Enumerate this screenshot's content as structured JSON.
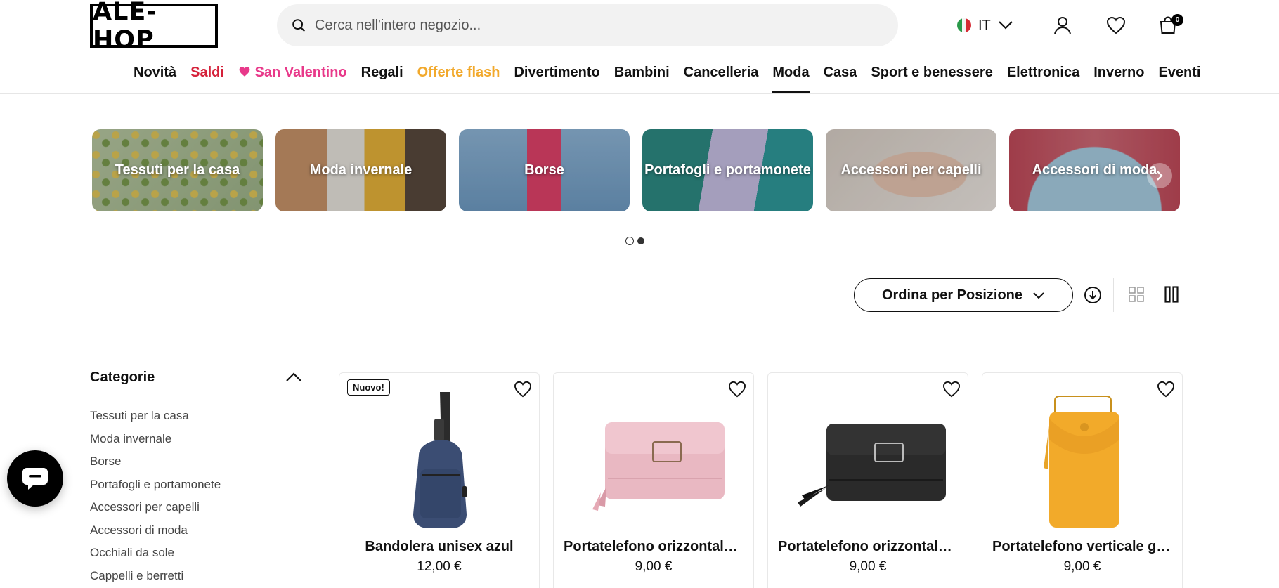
{
  "header": {
    "logo_text": "ALE-HOP",
    "search_placeholder": "Cerca nell'intero negozio...",
    "language": "IT",
    "cart_count": "0"
  },
  "nav": {
    "items": [
      {
        "label": "Novità",
        "color": "#111111"
      },
      {
        "label": "Saldi",
        "color": "#d5213a"
      },
      {
        "label": "San Valentino",
        "color": "#e8398a"
      },
      {
        "label": "Regali",
        "color": "#111111"
      },
      {
        "label": "Offerte flash",
        "color": "#f2a92c"
      },
      {
        "label": "Divertimento",
        "color": "#111111"
      },
      {
        "label": "Bambini",
        "color": "#111111"
      },
      {
        "label": "Cancelleria",
        "color": "#111111"
      },
      {
        "label": "Moda",
        "color": "#111111",
        "active": true
      },
      {
        "label": "Casa",
        "color": "#111111"
      },
      {
        "label": "Sport e benessere",
        "color": "#111111"
      },
      {
        "label": "Elettronica",
        "color": "#111111"
      },
      {
        "label": "Inverno",
        "color": "#111111"
      },
      {
        "label": "Eventi",
        "color": "#111111"
      }
    ]
  },
  "categories_carousel": {
    "cards": [
      {
        "label": "Tessuti per la casa"
      },
      {
        "label": "Moda invernale"
      },
      {
        "label": "Borse"
      },
      {
        "label": "Portafogli e portamonete"
      },
      {
        "label": "Accessori per capelli"
      },
      {
        "label": "Accessori di moda"
      }
    ],
    "pages": 2,
    "current_page": 1
  },
  "toolbar": {
    "sort_label": "Ordina per Posizione"
  },
  "sidebar": {
    "title": "Categorie",
    "items": [
      "Tessuti per la casa",
      "Moda invernale",
      "Borse",
      "Portafogli e portamonete",
      "Accessori per capelli",
      "Accessori di moda",
      "Occhiali da sole",
      "Cappelli e berretti"
    ]
  },
  "products": [
    {
      "badge": "Nuovo!",
      "name": "Bandolera unisex azul",
      "price": "12,00 €"
    },
    {
      "badge": "",
      "name": "Portatelefono orizzontale rosa",
      "price": "9,00 €"
    },
    {
      "badge": "",
      "name": "Portatelefono orizzontale nero",
      "price": "9,00 €"
    },
    {
      "badge": "",
      "name": "Portatelefono verticale giallo",
      "price": "9,00 €"
    }
  ],
  "colors": {
    "brand_black": "#000000",
    "sale_red": "#d5213a",
    "valentine_pink": "#e8398a",
    "flash_orange": "#f2a92c"
  }
}
